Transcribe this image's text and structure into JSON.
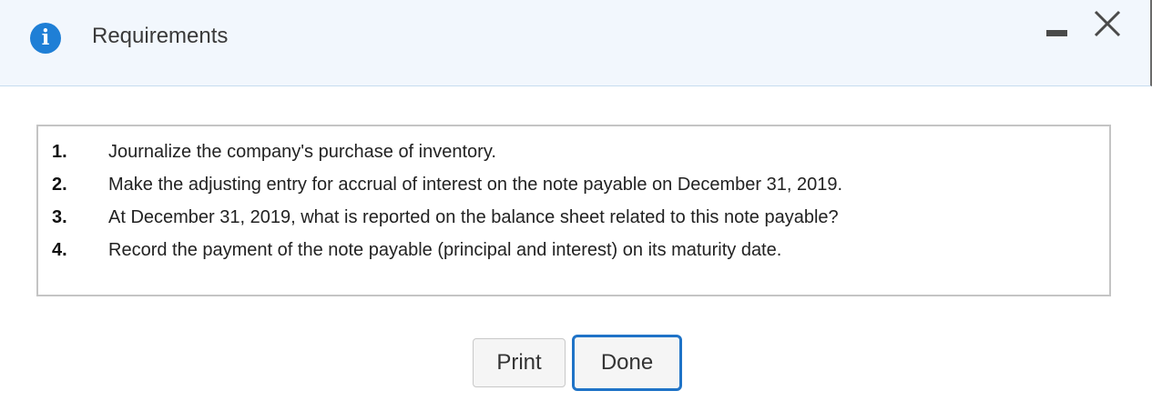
{
  "dialog": {
    "title": "Requirements",
    "icons": {
      "info": "info-icon",
      "minimize": "minimize-icon",
      "close": "close-icon"
    },
    "info_glyph": "i"
  },
  "requirements": [
    {
      "number": "1.",
      "text": "Journalize the company's purchase of inventory."
    },
    {
      "number": "2.",
      "text": "Make the adjusting entry for accrual of interest on the note payable on December 31, 2019."
    },
    {
      "number": "3.",
      "text": "At December 31, 2019, what is reported on the balance sheet related to this note payable?"
    },
    {
      "number": "4.",
      "text": "Record the payment of the note payable (principal and interest) on its maturity date."
    }
  ],
  "buttons": {
    "print_label": "Print",
    "done_label": "Done"
  },
  "colors": {
    "header_bg": "#f2f7fd",
    "info_icon": "#1f7fd6",
    "focus_border": "#1f73c7"
  }
}
